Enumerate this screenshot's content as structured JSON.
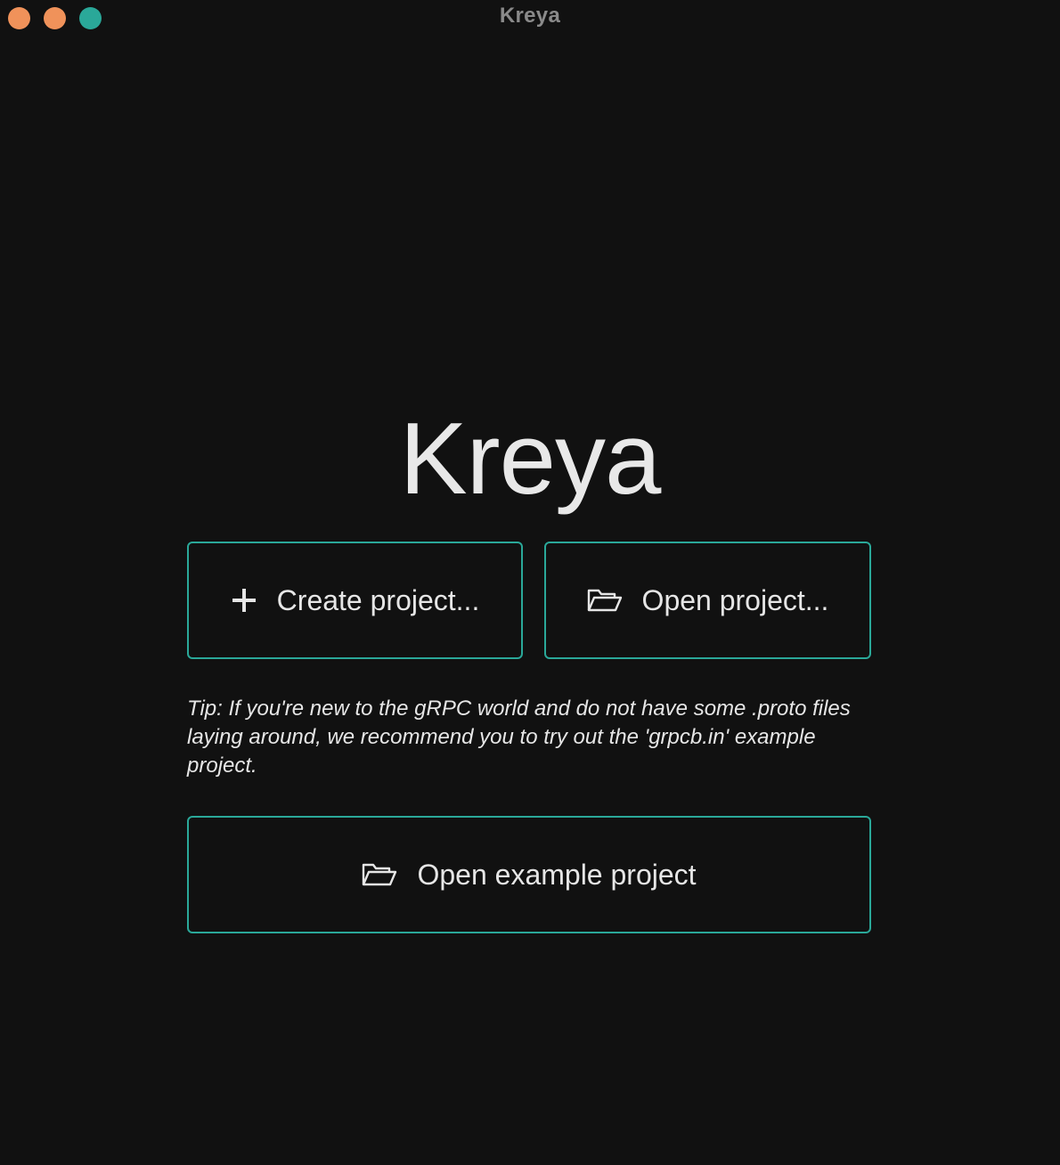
{
  "window": {
    "title": "Kreya",
    "traffic_lights": {
      "close_color": "#f0925a",
      "minimize_color": "#f0925a",
      "maximize_color": "#2aa899"
    }
  },
  "main": {
    "app_title": "Kreya",
    "create_button": {
      "label": "Create project...",
      "icon": "plus-icon"
    },
    "open_button": {
      "label": "Open project...",
      "icon": "folder-open-icon"
    },
    "tip": "Tip: If you're new to the gRPC world and do not have some .proto files laying around, we recommend you to try out the 'grpcb.in' example project.",
    "example_button": {
      "label": "Open example project",
      "icon": "folder-open-icon"
    }
  },
  "colors": {
    "background": "#111111",
    "accent": "#2aa899",
    "text": "#e6e6e6",
    "title_bar_text": "#8a8a8a"
  }
}
